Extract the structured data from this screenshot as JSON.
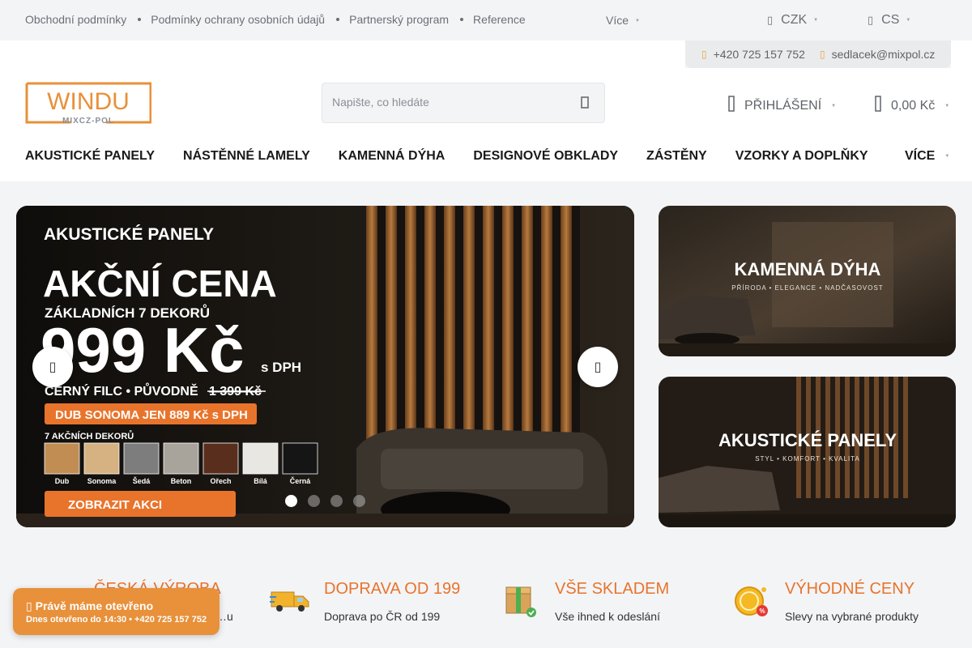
{
  "topbar": {
    "links": [
      "Obchodní podmínky",
      "Podmínky ochrany osobních údajů",
      "Partnerský program",
      "Reference"
    ],
    "more_label": "Více",
    "currency": "CZK",
    "language": "CS"
  },
  "contact": {
    "phone": "+420 725 157 752",
    "email": "sedlacek@mixpol.cz"
  },
  "header": {
    "logo_text": "WINDU",
    "logo_sub": "MIXCZ-POL",
    "search_placeholder": "Napište, co hledáte",
    "login_label": "PŘIHLÁŠENÍ",
    "cart_total": "0,00 Kč"
  },
  "nav": {
    "items": [
      "AKUSTICKÉ PANELY",
      "NÁSTĚNNÉ LAMELY",
      "KAMENNÁ DÝHA",
      "DESIGNOVÉ OBKLADY",
      "ZÁSTĚNY",
      "VZORKY A DOPLŇKY"
    ],
    "more_label": "VÍCE"
  },
  "hero": {
    "kicker": "AKUSTICKÉ PANELY",
    "headline": "AKČNÍ CENA",
    "subline": "ZÁKLADNÍCH 7 DEKORŮ",
    "price": "999 Kč",
    "price_note": "s DPH",
    "felt_line": "ČERNÝ FILC • PŮVODNĚ",
    "old_price": "1 399 Kč",
    "promo": "DUB SONOMA JEN 889 Kč s DPH",
    "decors_title": "7 AKČNÍCH DEKORŮ",
    "swatches": [
      {
        "name": "Dub",
        "color": "#c18d52"
      },
      {
        "name": "Sonoma",
        "color": "#d6b283"
      },
      {
        "name": "Šedá",
        "color": "#7d7d7d"
      },
      {
        "name": "Beton",
        "color": "#a9a49b"
      },
      {
        "name": "Ořech",
        "color": "#5a2e1c"
      },
      {
        "name": "Bílá",
        "color": "#e9e7e2"
      },
      {
        "name": "Černá",
        "color": "#151515"
      }
    ],
    "cta": "ZOBRAZIT AKCI",
    "slides": 4,
    "active_slide": 1
  },
  "banners": [
    {
      "title": "KAMENNÁ DÝHA",
      "subtitle": "PŘÍRODA • ELEGANCE • NADČASOVOST"
    },
    {
      "title": "AKUSTICKÉ PANELY",
      "subtitle": "STYL • KOMFORT • KVALITA"
    }
  ],
  "features": [
    {
      "title": "ČESKÁ VÝROBA",
      "subtitle": "…u"
    },
    {
      "title": "DOPRAVA OD 199",
      "subtitle": "Doprava po ČR od 199"
    },
    {
      "title": "VŠE SKLADEM",
      "subtitle": "Vše ihned k odeslání"
    },
    {
      "title": "VÝHODNÉ CENY",
      "subtitle": "Slevy na vybrané produkty"
    }
  ],
  "open_badge": {
    "title": "Právě máme otevřeno",
    "detail": "Dnes otevřeno do 14:30 • +420 725 157 752"
  },
  "colors": {
    "accent": "#e8742c",
    "orange_badge": "#e8903a"
  }
}
